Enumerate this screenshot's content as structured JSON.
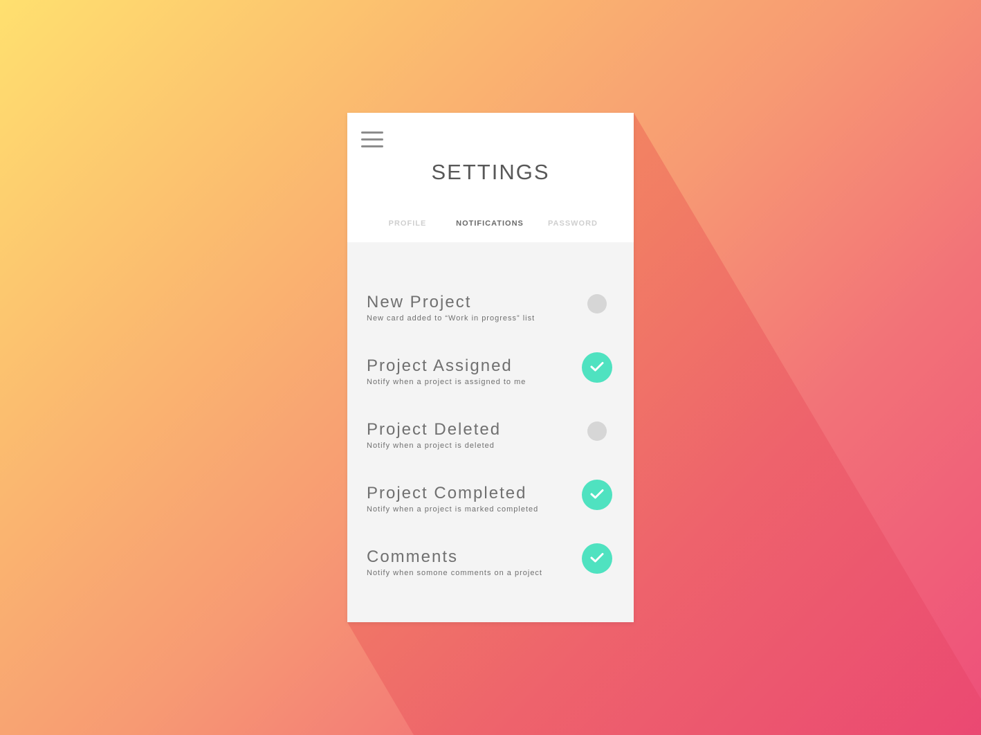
{
  "header": {
    "title": "SETTINGS",
    "menu_icon": "hamburger-menu-icon"
  },
  "tabs": [
    {
      "label": "PROFILE",
      "active": false
    },
    {
      "label": "NOTIFICATIONS",
      "active": true
    },
    {
      "label": "PASSWORD",
      "active": false
    }
  ],
  "settings": [
    {
      "title": "New Project",
      "description": "New card added to “Work in progress” list",
      "enabled": false
    },
    {
      "title": "Project Assigned",
      "description": "Notify when a project is assigned to me",
      "enabled": true
    },
    {
      "title": "Project Deleted",
      "description": "Notify when a project is deleted",
      "enabled": false
    },
    {
      "title": "Project Completed",
      "description": "Notify when a project is marked completed",
      "enabled": true
    },
    {
      "title": "Comments",
      "description": "Notify when somone comments on a project",
      "enabled": true
    }
  ],
  "colors": {
    "toggle_on": "#4fe2c0",
    "toggle_off": "#d6d6d6",
    "background_gradient": [
      "#ffe06f",
      "#f79a73",
      "#ee4f7a"
    ]
  }
}
